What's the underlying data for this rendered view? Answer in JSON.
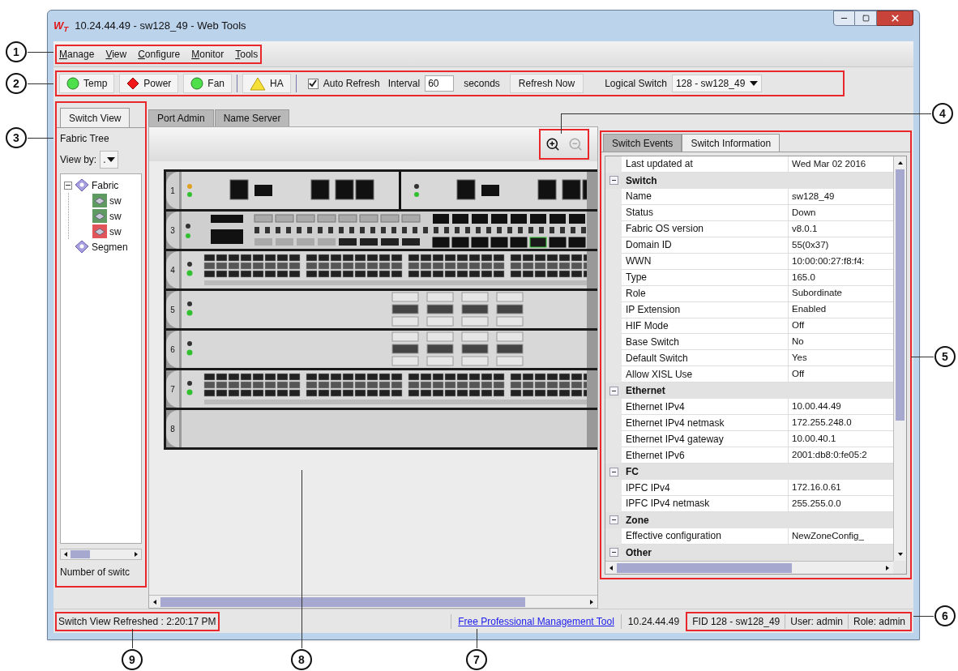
{
  "window": {
    "logo": "W$_{T}$",
    "title": "10.24.44.49 - sw128_49 - Web Tools"
  },
  "menu": [
    "Manage",
    "View",
    "Configure",
    "Monitor",
    "Tools"
  ],
  "toolbar": {
    "status": [
      {
        "label": "Temp",
        "kind": "ok"
      },
      {
        "label": "Power",
        "kind": "error"
      },
      {
        "label": "Fan",
        "kind": "ok"
      },
      {
        "label": "HA",
        "kind": "warning"
      }
    ],
    "auto_refresh": {
      "label": "Auto Refresh",
      "checked": true
    },
    "interval": {
      "label": "Interval",
      "value": "60",
      "unit": "seconds"
    },
    "refresh_button": "Refresh Now",
    "logical_switch": {
      "label": "Logical Switch",
      "value": "128 - sw128_49"
    }
  },
  "tabs": [
    {
      "label": "Switch View",
      "selected": true
    },
    {
      "label": "Port Admin",
      "selected": false
    },
    {
      "label": "Name Server",
      "selected": false
    }
  ],
  "fabric_tree": {
    "title": "Fabric Tree",
    "view_by_label": "View by:",
    "view_by_value": ".",
    "items": [
      {
        "label": "Fabric",
        "expanded": true,
        "children": [
          {
            "label": "sw",
            "color": "#5f9a63"
          },
          {
            "label": "sw",
            "color": "#5f9a63"
          },
          {
            "label": "sw",
            "color": "#e0545a"
          }
        ]
      },
      {
        "label": "Segmen"
      }
    ],
    "footer": "Number of switc"
  },
  "chassis": {
    "slots": [
      {
        "label": "1",
        "kind": "cp"
      },
      {
        "label": "3",
        "kind": "fc"
      },
      {
        "label": "4",
        "kind": "ports"
      },
      {
        "label": "5",
        "kind": "extension"
      },
      {
        "label": "6",
        "kind": "extension"
      },
      {
        "label": "7",
        "kind": "ports"
      },
      {
        "label": "8",
        "kind": "empty"
      }
    ]
  },
  "info_tabs": [
    {
      "label": "Switch Events",
      "selected": false
    },
    {
      "label": "Switch Information",
      "selected": true
    }
  ],
  "properties": {
    "header": {
      "name": "Last updated at",
      "value": "Wed Mar 02 2016"
    },
    "groups": [
      {
        "name": "Switch",
        "expanded": true,
        "rows": [
          {
            "name": "Name",
            "value": "sw128_49"
          },
          {
            "name": "Status",
            "value": "Down"
          },
          {
            "name": "Fabric OS version",
            "value": "v8.0.1"
          },
          {
            "name": "Domain ID",
            "value": "55(0x37)"
          },
          {
            "name": "WWN",
            "value": "10:00:00:27:f8:f4:"
          },
          {
            "name": "Type",
            "value": "165.0"
          },
          {
            "name": "Role",
            "value": "Subordinate"
          },
          {
            "name": "IP Extension",
            "value": "Enabled"
          },
          {
            "name": "HIF Mode",
            "value": "Off"
          },
          {
            "name": "Base Switch",
            "value": "No"
          },
          {
            "name": "Default Switch",
            "value": "Yes"
          },
          {
            "name": "Allow XISL Use",
            "value": "Off"
          }
        ]
      },
      {
        "name": "Ethernet",
        "expanded": true,
        "rows": [
          {
            "name": "Ethernet IPv4",
            "value": "10.00.44.49"
          },
          {
            "name": "Ethernet IPv4 netmask",
            "value": "172.255.248.0"
          },
          {
            "name": "Ethernet IPv4 gateway",
            "value": "10.00.40.1"
          },
          {
            "name": "Ethernet IPv6",
            "value": "2001:db8:0:fe05:2"
          }
        ]
      },
      {
        "name": "FC",
        "expanded": true,
        "rows": [
          {
            "name": "IPFC IPv4",
            "value": "172.16.0.61"
          },
          {
            "name": "IPFC IPv4 netmask",
            "value": "255.255.0.0"
          }
        ]
      },
      {
        "name": "Zone",
        "expanded": true,
        "rows": [
          {
            "name": "Effective configuration",
            "value": "NewZoneConfig_"
          }
        ]
      },
      {
        "name": "Other",
        "expanded": true
      }
    ]
  },
  "status_bar": {
    "refreshed": "Switch View Refreshed : 2:20:17 PM",
    "link": "Free Professional Management Tool",
    "ip": "10.24.44.49",
    "fid": "FID 128 - sw128_49",
    "user": "User: admin",
    "role": "Role: admin"
  },
  "callouts": [
    "1",
    "2",
    "3",
    "4",
    "5",
    "6",
    "9",
    "8",
    "7"
  ]
}
